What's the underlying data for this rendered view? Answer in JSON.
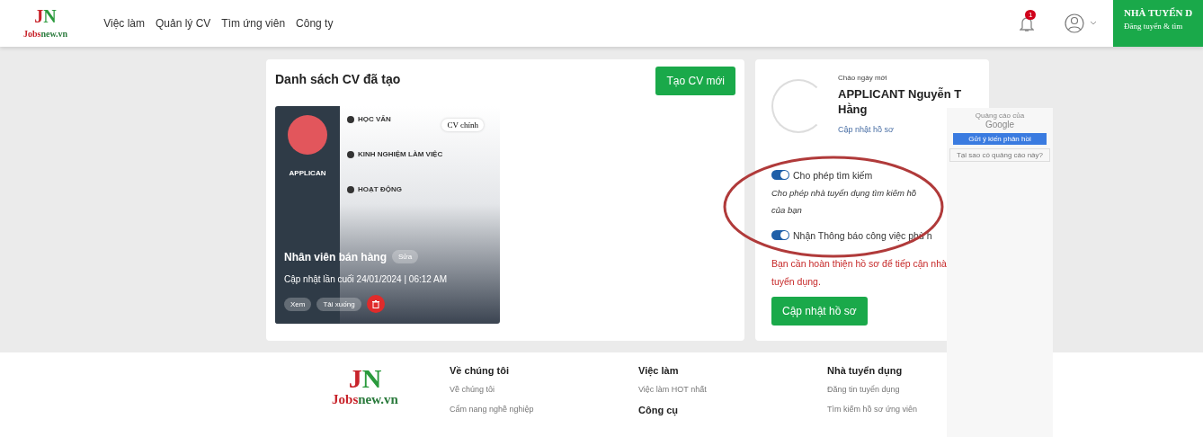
{
  "header": {
    "logo": {
      "mark_j": "J",
      "mark_n": "N",
      "text_a": "Jobs",
      "text_b": "new.vn"
    },
    "nav": [
      {
        "label": "Việc làm"
      },
      {
        "label": "Quản lý CV"
      },
      {
        "label": "Tìm ứng viên"
      },
      {
        "label": "Công ty"
      }
    ],
    "notifications": {
      "count": "1"
    },
    "employer_banner": {
      "title": "NHÀ TUYỂN D",
      "subtitle": "Đăng tuyển & tìm"
    }
  },
  "cv_list": {
    "title": "Danh sách CV đã tạo",
    "create_button": "Tạo CV mới",
    "cvs": [
      {
        "preview": {
          "name": "APPLICAN",
          "sections": [
            "HỌC VẤN",
            "KINH NGHIỆM LÀM VIỆC",
            "HOẠT ĐỘNG"
          ]
        },
        "main_badge": "CV chính",
        "title": "Nhân viên bán hàng",
        "edit": "Sửa",
        "updated": "Cập nhật lần cuối 24/01/2024 | 06:12 AM",
        "actions": [
          "Xem",
          "Tải xuống"
        ]
      }
    ]
  },
  "profile": {
    "greeting": "Chào ngày mới",
    "name": "APPLICANT Nguyễn T",
    "name_line2": "Hằng",
    "update_link": "Cập nhật hồ sơ",
    "toggles": [
      {
        "label": "Cho phép tìm kiếm",
        "on": true,
        "description": "Cho phép nhà tuyển dụng tìm kiếm hồ",
        "description_line2": "của bạn"
      },
      {
        "label": "Nhận Thông báo công việc phù h",
        "on": true
      }
    ],
    "warning": "Bạn cần hoàn thiện hồ sơ để tiếp cận nhà tuyển dụng.",
    "update_button": "Cập nhật hồ sơ"
  },
  "ad": {
    "label": "Quảng cáo của",
    "brand": "Google",
    "feedback_button": "Gửi ý kiến phản hồi",
    "why_link": "Tại sao có quảng cáo này?"
  },
  "footer": {
    "logo": {
      "mark_j": "J",
      "mark_n": "N",
      "text_a": "Jobs",
      "text_b": "new.vn"
    },
    "columns": [
      {
        "heading": "Về chúng tôi",
        "links": [
          "Về chúng tôi",
          "Cẩm nang nghề nghiệp"
        ]
      },
      {
        "heading": "Việc làm",
        "links": [
          "Việc làm HOT nhất"
        ],
        "heading2": "Công cụ"
      },
      {
        "heading": "Nhà tuyển dụng",
        "links": [
          "Đăng tin tuyển dụng",
          "Tìm kiếm hồ sơ ứng viên"
        ]
      }
    ]
  }
}
